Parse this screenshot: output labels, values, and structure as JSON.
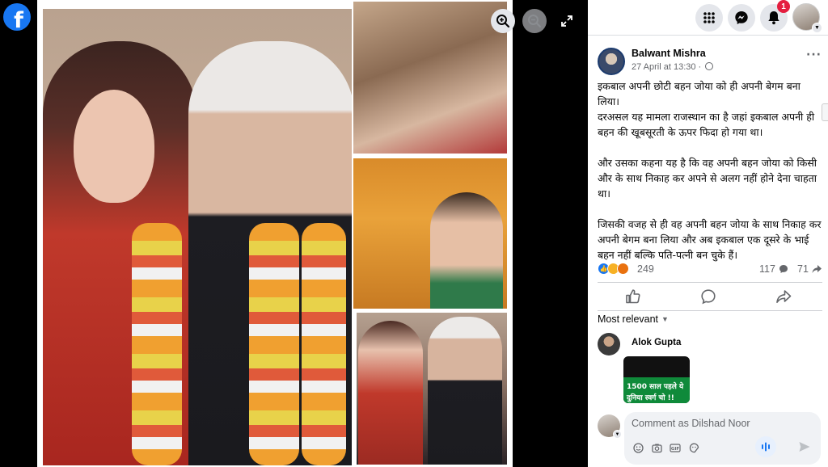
{
  "viewer": {
    "logo_letter": "f",
    "zoom_in_label": "Zoom in",
    "zoom_out_label": "Zoom out",
    "fullscreen_label": "Enter full screen"
  },
  "topbar": {
    "notifications_badge": "1"
  },
  "post": {
    "author": "Balwant Mishra",
    "time": "27 April at 13:30 ·",
    "more_label": "···",
    "paragraphs": [
      "इकबाल अपनी छोटी बहन जोया को ही अपनी बेगम बना लिया।\nदरअसल यह मामला राजस्थान का है जहां इकबाल अपनी ही बहन की खूबसूरती के ऊपर फिदा हो गया था।",
      "और उसका कहना यह है कि वह अपनी बहन जोया को किसी और के साथ निकाह कर अपने से अलग नहीं होने देना चाहता था।",
      "जिसकी वजह से ही वह अपनी बहन जोया के साथ निकाह कर अपनी बेगम बना लिया और अब इकबाल एक दूसरे के भाई बहन नहीं बल्कि पति-पत्नी बन चुके हैं।"
    ],
    "reaction_count": "249",
    "comment_count": "117",
    "share_count": "71"
  },
  "comments": {
    "sort_label": "Most relevant",
    "items": [
      {
        "name": "Alok Gupta",
        "image_line1": "1500 साल पहले ये",
        "image_line2": "दुनिया स्वर्ग चो !!"
      }
    ],
    "compose_placeholder": "Comment as Dilshad Noor"
  },
  "colors": {
    "brand": "#1877f2",
    "badge": "#e41e3f"
  }
}
